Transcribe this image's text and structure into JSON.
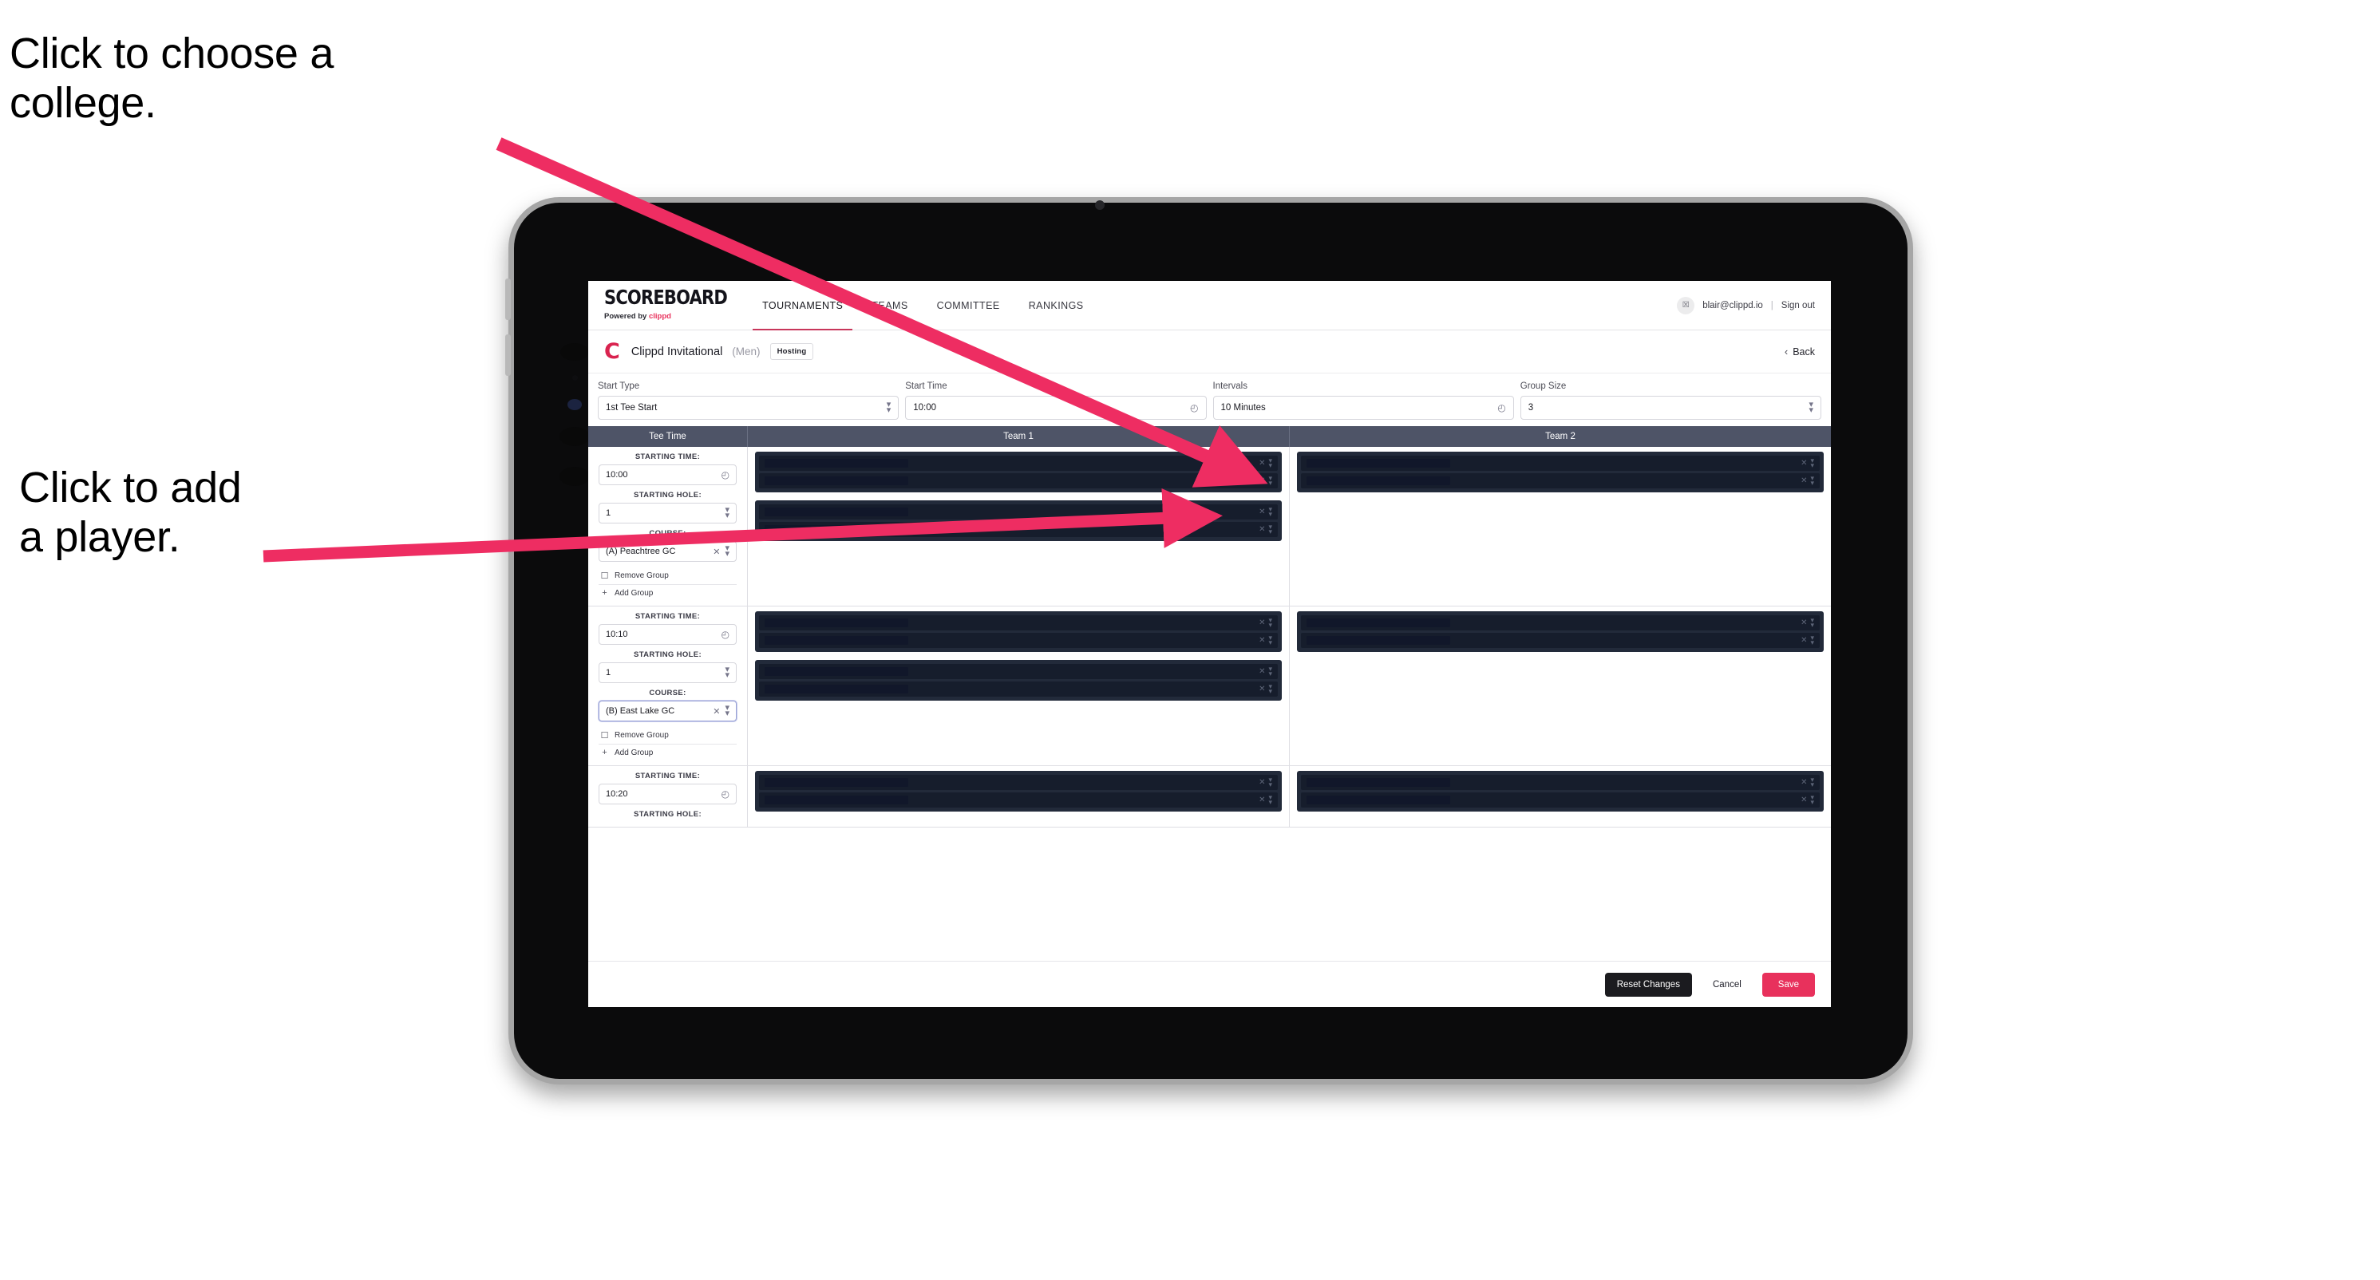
{
  "annotations": {
    "college": "Click to choose a\ncollege.",
    "player": "Click to add\na player."
  },
  "colors": {
    "accent_pink": "#e8315c",
    "arrow_pink": "#ee2d62",
    "header_slate": "#4e5467",
    "player_box_dark": "#222a3a",
    "player_row_dark": "#161d2c"
  },
  "nav": {
    "brand_title": "SCOREBOARD",
    "brand_sub_prefix": "Powered by ",
    "brand_sub_accent": "clippd",
    "tabs": [
      {
        "label": "TOURNAMENTS",
        "active": true
      },
      {
        "label": "TEAMS",
        "active": false
      },
      {
        "label": "COMMITTEE",
        "active": false
      },
      {
        "label": "RANKINGS",
        "active": false
      }
    ],
    "account_email": "blair@clippd.io",
    "separator": "|",
    "sign_out": "Sign out",
    "avatar_glyph": "☒"
  },
  "tournament": {
    "logo_letter": "C",
    "name": "Clippd Invitational",
    "gender": "(Men)",
    "badge": "Hosting",
    "back_chevron": "‹",
    "back_label": "Back"
  },
  "settings": [
    {
      "label": "Start Type",
      "value": "1st Tee Start",
      "control": "select"
    },
    {
      "label": "Start Time",
      "value": "10:00",
      "control": "time"
    },
    {
      "label": "Intervals",
      "value": "10 Minutes",
      "control": "time"
    },
    {
      "label": "Group Size",
      "value": "3",
      "control": "select"
    }
  ],
  "table": {
    "headers": {
      "tee_time": "Tee Time",
      "team1": "Team 1",
      "team2": "Team 2"
    },
    "labels": {
      "starting_time": "STARTING TIME:",
      "starting_hole": "STARTING HOLE:",
      "course": "COURSE:",
      "remove_group": "Remove Group",
      "add_group": "Add Group",
      "remove_glyph": "☐",
      "add_glyph": "+",
      "clock_glyph": "◴",
      "clear_glyph": "✕"
    },
    "groups": [
      {
        "starting_time": "10:00",
        "starting_hole": "1",
        "course": "(A) Peachtree GC",
        "course_focused": false,
        "team1_boxes": [
          {
            "rows": 2
          },
          {
            "rows": 2
          }
        ],
        "team2_boxes": [
          {
            "rows": 2
          }
        ]
      },
      {
        "starting_time": "10:10",
        "starting_hole": "1",
        "course": "(B) East Lake GC",
        "course_focused": true,
        "team1_boxes": [
          {
            "rows": 2
          },
          {
            "rows": 2
          }
        ],
        "team2_boxes": [
          {
            "rows": 2
          }
        ]
      },
      {
        "starting_time": "10:20",
        "starting_hole": "",
        "course": "",
        "course_focused": false,
        "team1_boxes": [
          {
            "rows": 2
          }
        ],
        "team2_boxes": [
          {
            "rows": 2
          }
        ]
      }
    ]
  },
  "footer": {
    "reset": "Reset Changes",
    "cancel": "Cancel",
    "save": "Save"
  }
}
